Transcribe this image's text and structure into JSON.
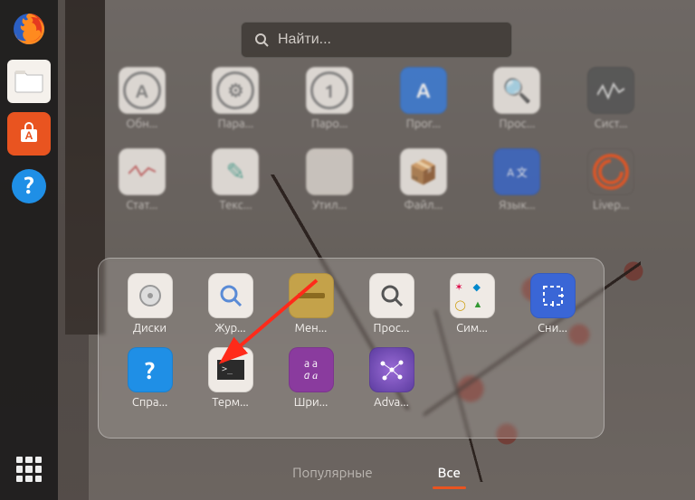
{
  "search": {
    "placeholder": "Найти..."
  },
  "dock": {
    "items": [
      {
        "name": "firefox"
      },
      {
        "name": "files"
      },
      {
        "name": "software-center"
      },
      {
        "name": "help"
      }
    ],
    "apps_button": "show-applications"
  },
  "background_grid": {
    "row1": [
      {
        "label": "Обн...",
        "icon": "update"
      },
      {
        "label": "Пара...",
        "icon": "settings"
      },
      {
        "label": "Паро...",
        "icon": "passwords"
      },
      {
        "label": "Прог...",
        "icon": "software"
      },
      {
        "label": "Прос...",
        "icon": "magnifier"
      },
      {
        "label": "Сист...",
        "icon": "system-monitor"
      }
    ],
    "row2": [
      {
        "label": "Стат...",
        "icon": "power-stats"
      },
      {
        "label": "Текс...",
        "icon": "text-editor"
      },
      {
        "label": "Утил...",
        "icon": "utilities-folder"
      },
      {
        "label": "Файл...",
        "icon": "archive"
      },
      {
        "label": "Язык...",
        "icon": "language"
      },
      {
        "label": "Livep...",
        "icon": "livepatch"
      }
    ]
  },
  "folder": {
    "row1": [
      {
        "label": "Диски",
        "icon": "disks"
      },
      {
        "label": "Жур...",
        "icon": "logs"
      },
      {
        "label": "Мен...",
        "icon": "archive-manager"
      },
      {
        "label": "Прос...",
        "icon": "image-viewer"
      },
      {
        "label": "Сим...",
        "icon": "characters"
      },
      {
        "label": "Сни...",
        "icon": "screenshot"
      }
    ],
    "row2": [
      {
        "label": "Спра...",
        "icon": "help"
      },
      {
        "label": "Терм...",
        "icon": "terminal"
      },
      {
        "label": "Шри...",
        "icon": "fonts"
      },
      {
        "label": "Adva...",
        "icon": "advanced-network"
      }
    ]
  },
  "tabs": {
    "frequent": "Популярные",
    "all": "Все",
    "active": "all"
  },
  "annotation": {
    "arrow_points_to": "terminal"
  }
}
